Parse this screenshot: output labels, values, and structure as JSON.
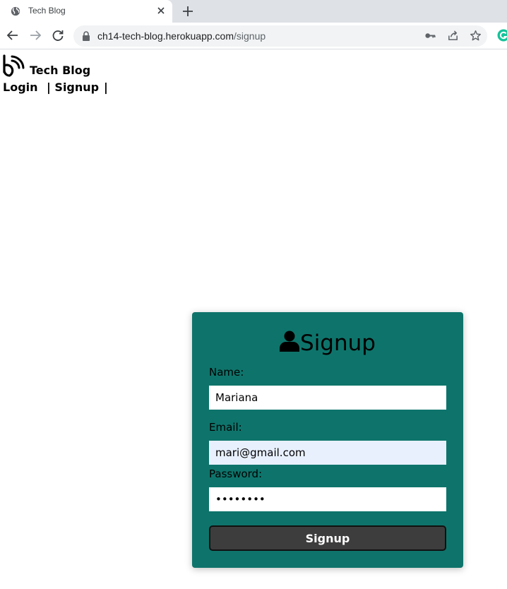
{
  "browser": {
    "tab_title": "Tech Blog",
    "url_host": "ch14-tech-blog.herokuapp.com",
    "url_path": "/signup"
  },
  "header": {
    "site_title": "Tech Blog",
    "nav_login": "Login",
    "nav_sep1": "| Signup",
    "nav_sep2": "|"
  },
  "form": {
    "title": "Signup",
    "name_label": "Name:",
    "name_value": "Mariana",
    "email_label": "Email:",
    "email_value": "mari@gmail.com",
    "password_label": "Password:",
    "password_value": "mariana1",
    "submit_label": "Signup"
  },
  "colors": {
    "card_bg": "#0e746b",
    "button_bg": "#3d3d3d",
    "autofill_bg": "#e8f0fe"
  }
}
